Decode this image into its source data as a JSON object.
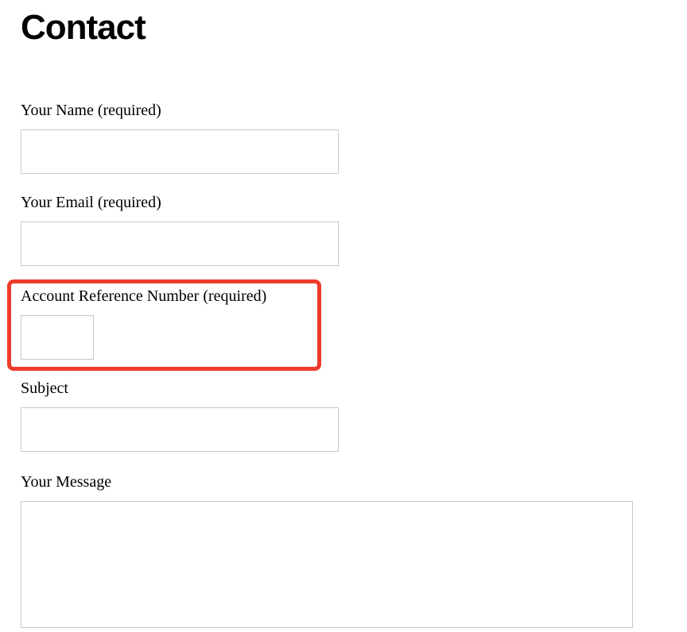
{
  "page": {
    "title": "Contact"
  },
  "form": {
    "name": {
      "label": "Your Name (required)",
      "value": ""
    },
    "email": {
      "label": "Your Email (required)",
      "value": ""
    },
    "account": {
      "label": "Account Reference Number (required)",
      "value": ""
    },
    "subject": {
      "label": "Subject",
      "value": ""
    },
    "message": {
      "label": "Your Message",
      "value": ""
    }
  },
  "highlight": {
    "color": "#ee3a2b"
  }
}
